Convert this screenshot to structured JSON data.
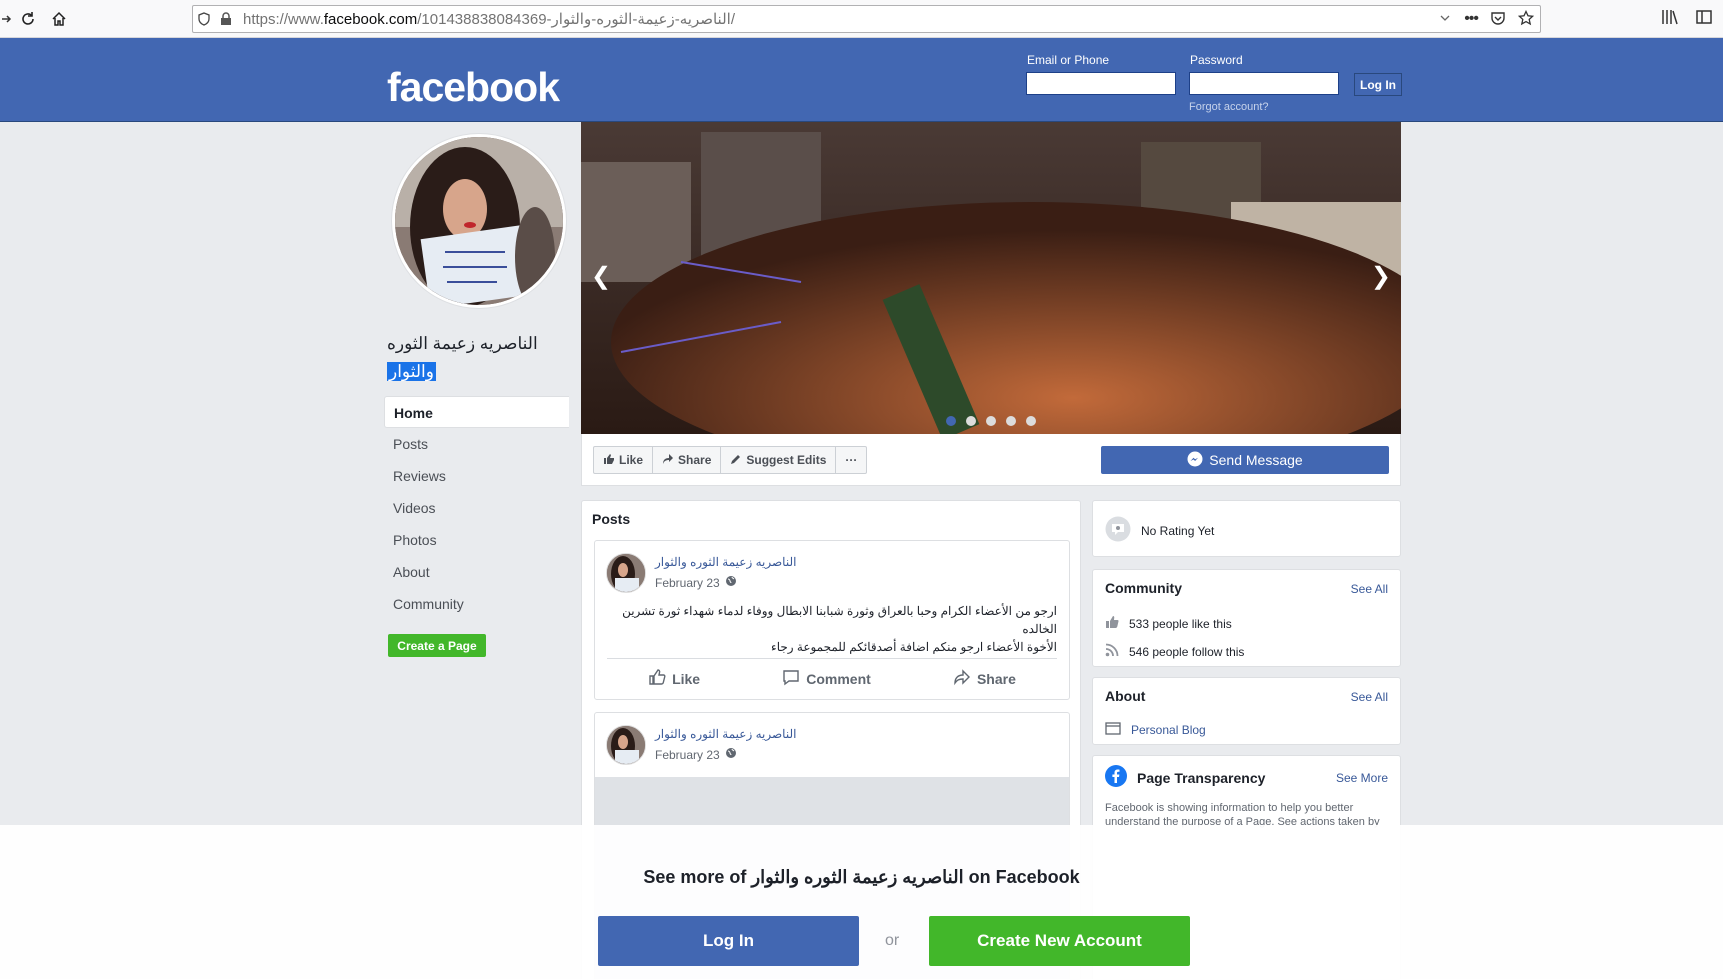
{
  "browser": {
    "url_prefix": "https://www.",
    "url_host": "facebook.com",
    "url_path": "/101438838084369-الناصريه-زعيمة-الثوره-والثوار/"
  },
  "header": {
    "logo": "facebook",
    "email_label": "Email or Phone",
    "password_label": "Password",
    "login_button": "Log In",
    "forgot": "Forgot account?"
  },
  "page": {
    "name_line1": "الناصريه زعيمة الثوره",
    "name_line2": "والثوار"
  },
  "left_nav": {
    "items": [
      "Home",
      "Posts",
      "Reviews",
      "Videos",
      "Photos",
      "About",
      "Community"
    ],
    "create_page": "Create a Page"
  },
  "actions": {
    "like": "Like",
    "share": "Share",
    "suggest": "Suggest Edits",
    "more": "···",
    "send_message": "Send Message"
  },
  "posts": {
    "title": "Posts",
    "items": [
      {
        "author": "الناصريه زعيمة الثوره والثوار",
        "date": "February 23",
        "text_line1": "ارجو من الأعضاء الكرام وحبا بالعراق وثورة شبابنا الابطال ووفاء لدماء شهداء ثورة تشرين الخالده",
        "text_line2": "الأخوة الأعضاء ارجو منكم اضافة أصدقائكم للمجموعة رجاء",
        "like": "Like",
        "comment": "Comment",
        "share": "Share"
      },
      {
        "author": "الناصريه زعيمة الثوره والثوار",
        "date": "February 23"
      }
    ]
  },
  "right": {
    "rating": "No Rating Yet",
    "community_title": "Community",
    "see_all": "See All",
    "likes": "533 people like this",
    "follows": "546 people follow this",
    "about_title": "About",
    "about_see_all": "See All",
    "category": "Personal Blog",
    "transparency_title": "Page Transparency",
    "see_more": "See More",
    "transparency_desc": "Facebook is showing information to help you better understand the purpose of a Page. See actions taken by"
  },
  "overlay": {
    "see_more_prefix": "See more of",
    "see_more_name": "الناصريه زعيمة الثوره والثوار",
    "see_more_suffix": "on Facebook",
    "login": "Log In",
    "or": "or",
    "create": "Create New Account"
  },
  "colors": {
    "fb_blue": "#4267b2",
    "green": "#42b72a",
    "link": "#385898"
  }
}
